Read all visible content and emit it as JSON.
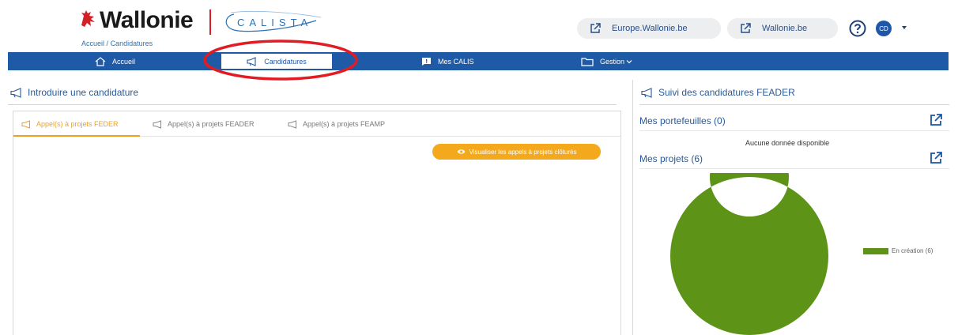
{
  "header": {
    "brand_name": "Wallonie",
    "app_name": "CALISTA",
    "breadcrumb": {
      "home": "Accueil",
      "separator": "/",
      "current": "Candidatures"
    },
    "links": [
      {
        "label": "Europe.Wallonie.be",
        "icon": "external-link-icon"
      },
      {
        "label": "Wallonie.be",
        "icon": "external-link-icon"
      }
    ],
    "help_icon": "help-icon",
    "user_initials": "CD"
  },
  "nav": {
    "items": [
      {
        "label": "Accueil",
        "icon": "home-icon"
      },
      {
        "label": "Candidatures",
        "icon": "megaphone-icon",
        "active": true
      },
      {
        "label": "Mes CALIS",
        "icon": "message-icon"
      },
      {
        "label": "Gestion",
        "icon": "folder-icon",
        "dropdown": true
      }
    ]
  },
  "left": {
    "title": "Introduire une candidature",
    "tabs": [
      {
        "label": "Appel(s) à projets FEDER",
        "active": true
      },
      {
        "label": "Appel(s) à projets FEADER"
      },
      {
        "label": "Appel(s) à projets FEAMP"
      }
    ],
    "archive_button": "Visualiser les appels à projets clôturés"
  },
  "right": {
    "title": "Suivi des candidatures FEADER",
    "portfolios": "Mes portefeuilles (0)",
    "no_data": "Aucune donnée disponible",
    "projects": "Mes projets (6)",
    "legend_label": "En création (6)"
  },
  "chart_data": {
    "type": "pie",
    "categories": [
      "En création (6)"
    ],
    "values": [
      6
    ]
  },
  "colors": {
    "nav_blue": "#1f5aa6",
    "brand_red": "#d32027",
    "accent_orange": "#f4a81c",
    "donut_green": "#5d9317",
    "link_blue": "#2a5a9a",
    "highlight_red": "#e31b23"
  }
}
